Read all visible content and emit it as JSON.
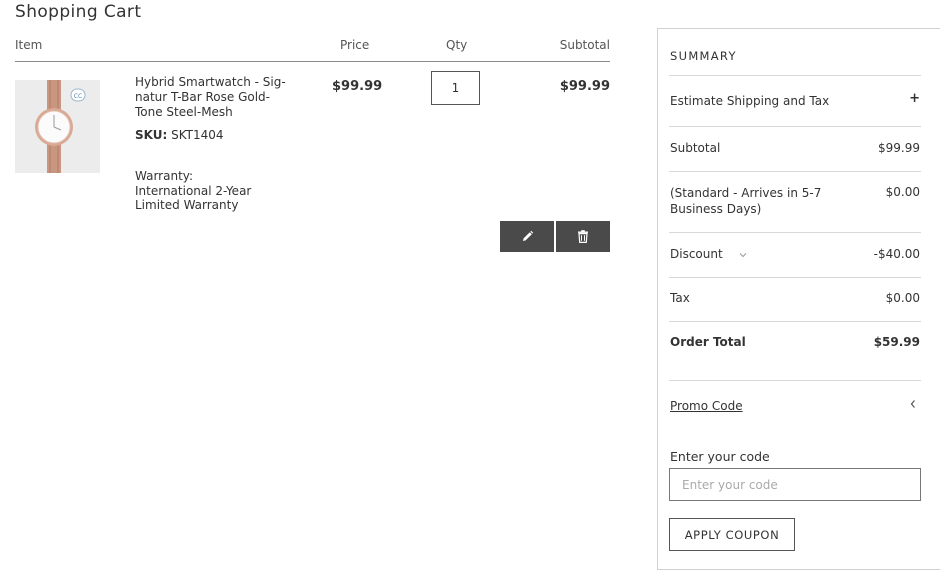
{
  "page": {
    "title": "Shopping Cart"
  },
  "table": {
    "headers": {
      "item": "Item",
      "price": "Price",
      "qty": "Qty",
      "subtotal": "Subtotal"
    }
  },
  "cart_item": {
    "name": "Hybrid Smartwatch - Sig-natur T-Bar Rose Gold-Tone Steel-Mesh",
    "sku_label": "SKU:",
    "sku_value": "SKT1404",
    "warranty_label": "Warranty:",
    "warranty_value": "International 2-Year Limited Warranty",
    "price": "$99.99",
    "qty": "1",
    "subtotal": "$99.99",
    "thumbnail_icon": "watch-image"
  },
  "actions": {
    "edit_icon": "pencil-icon",
    "delete_icon": "trash-icon"
  },
  "summary": {
    "title": "SUMMARY",
    "estimate_label": "Estimate Shipping and Tax",
    "estimate_toggle": "+",
    "subtotal_label": "Subtotal",
    "subtotal_value": "$99.99",
    "shipping_label": "(Standard - Arrives in 5-7 Business Days)",
    "shipping_value": "$0.00",
    "discount_label": "Discount",
    "discount_value": "-$40.00",
    "tax_label": "Tax",
    "tax_value": "$0.00",
    "order_total_label": "Order Total",
    "order_total_value": "$59.99",
    "promo_label": "Promo Code",
    "code_label": "Enter your code",
    "code_placeholder": "Enter your code",
    "coupon_button": "APPLY COUPON"
  },
  "colors": {
    "action_button_bg": "#4a4a4a",
    "text": "#333333",
    "divider": "#d8d8d8"
  }
}
